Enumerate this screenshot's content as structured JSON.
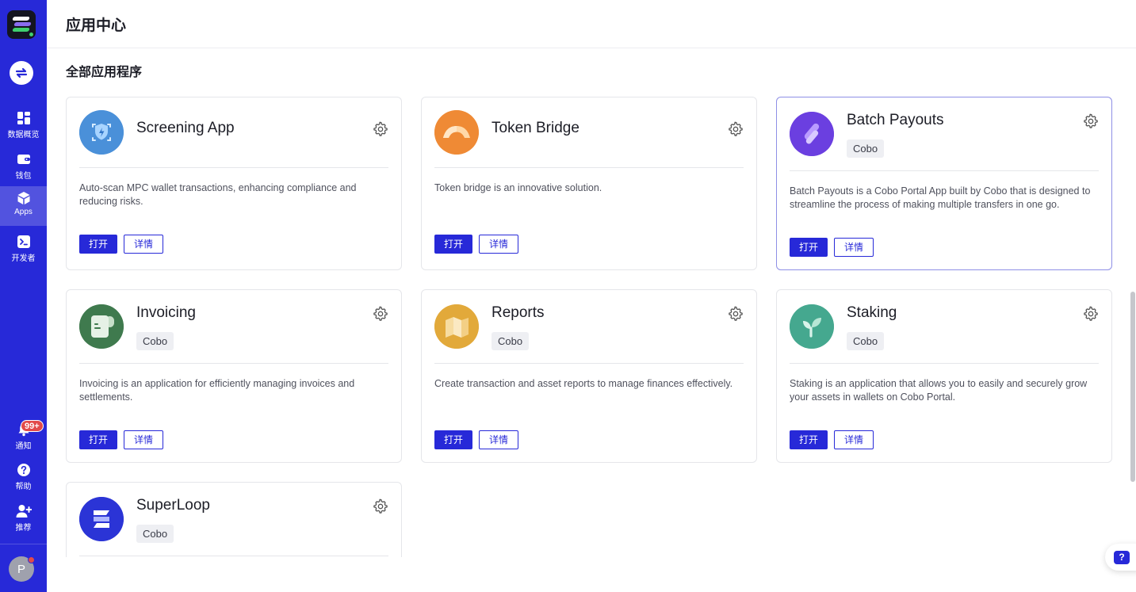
{
  "sidebar": {
    "nav": [
      {
        "label": "数据概览",
        "icon": "dashboard-icon"
      },
      {
        "label": "钱包",
        "icon": "wallet-icon"
      },
      {
        "label": "Apps",
        "icon": "apps-icon"
      },
      {
        "label": "开发者",
        "icon": "developer-icon"
      }
    ],
    "notifications": {
      "label": "通知",
      "badge": "99+"
    },
    "help": {
      "label": "帮助"
    },
    "refer": {
      "label": "推荐"
    },
    "avatar": "P"
  },
  "header": {
    "title": "应用中心"
  },
  "section": {
    "title": "全部应用程序"
  },
  "buttons": {
    "open": "打开",
    "detail": "详情"
  },
  "apps": [
    {
      "name": "Screening App",
      "desc": "Auto-scan MPC wallet transactions, enhancing compliance and reducing risks.",
      "icon": "screening-shield-icon",
      "color": "#4a90d9"
    },
    {
      "name": "Token Bridge",
      "desc": "Token bridge is an innovative solution.",
      "icon": "bridge-icon",
      "color": "#ef8a35"
    },
    {
      "name": "Batch Payouts",
      "tag": "Cobo",
      "desc": "Batch Payouts is a Cobo Portal App built by Cobo that is designed to streamline the process of making multiple transfers in one go.",
      "icon": "batch-payouts-icon",
      "color": "#6b3fe0"
    },
    {
      "name": "Invoicing",
      "tag": "Cobo",
      "desc": "Invoicing is an application for efficiently managing invoices and settlements.",
      "icon": "invoice-icon",
      "color": "#3f7a4e"
    },
    {
      "name": "Reports",
      "tag": "Cobo",
      "desc": "Create transaction and asset reports to manage finances effectively.",
      "icon": "reports-icon",
      "color": "#e2a93a"
    },
    {
      "name": "Staking",
      "tag": "Cobo",
      "desc": "Staking is an application that allows you to easily and securely grow your assets in wallets on Cobo Portal.",
      "icon": "staking-sprout-icon",
      "color": "#45a88f"
    },
    {
      "name": "SuperLoop",
      "tag": "Cobo",
      "icon": "superloop-icon",
      "color": "#2b34d6"
    }
  ],
  "colors": {
    "primary": "#2729d8",
    "badge": "#e24a4a",
    "border": "#e5e6ea"
  }
}
